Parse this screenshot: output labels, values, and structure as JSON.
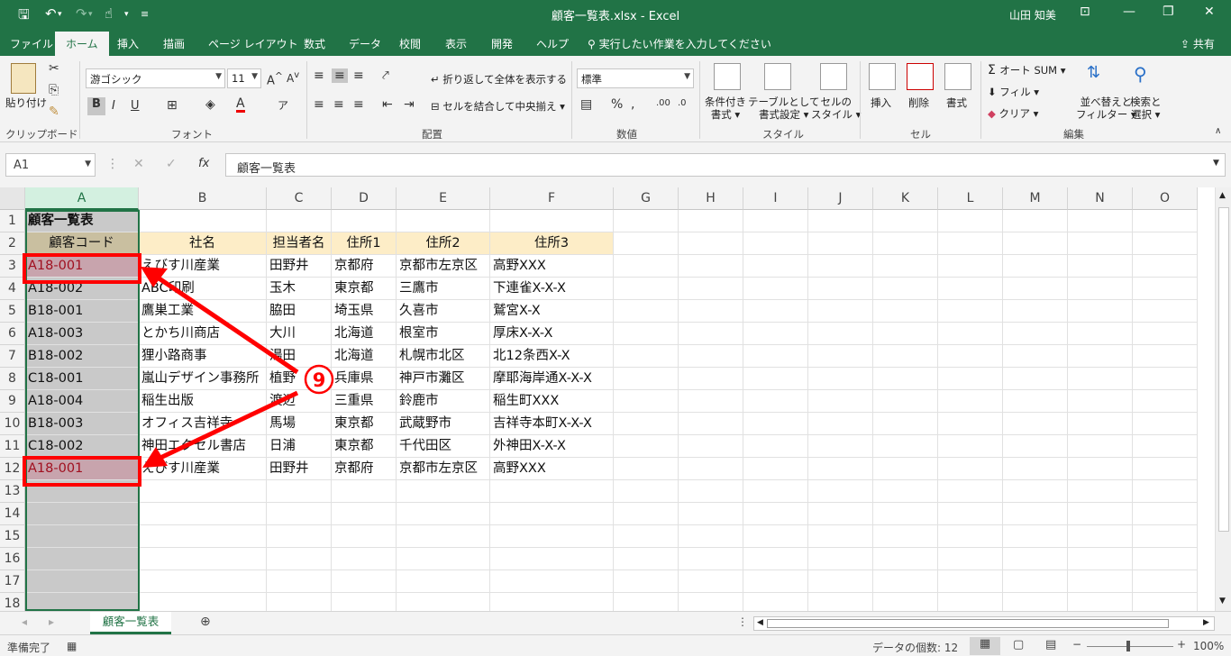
{
  "titlebar": {
    "title": "顧客一覧表.xlsx  -  Excel",
    "user": "山田 知美"
  },
  "tabs": [
    "ファイル",
    "ホーム",
    "挿入",
    "描画",
    "ページ レイアウト",
    "数式",
    "データ",
    "校閲",
    "表示",
    "開発",
    "ヘルプ"
  ],
  "tell_me": "実行したい作業を入力してください",
  "share": "共有",
  "ribbon": {
    "clipboard": {
      "label": "クリップボード",
      "paste": "貼り付け"
    },
    "font": {
      "label": "フォント",
      "name": "游ゴシック",
      "size": "11"
    },
    "alignment": {
      "label": "配置",
      "wrap": "折り返して全体を表示する",
      "merge": "セルを結合して中央揃え"
    },
    "number": {
      "label": "数値",
      "format": "標準"
    },
    "styles": {
      "label": "スタイル",
      "cond_line1": "条件付き",
      "cond_line2": "書式",
      "table_line1": "テーブルとして",
      "table_line2": "書式設定",
      "cell_line1": "セルの",
      "cell_line2": "スタイル"
    },
    "cells": {
      "label": "セル",
      "insert": "挿入",
      "delete": "削除",
      "format": "書式"
    },
    "editing": {
      "label": "編集",
      "autosum": "オート SUM",
      "fill": "フィル",
      "clear": "クリア",
      "sort_line1": "並べ替えと",
      "sort_line2": "フィルター",
      "find_line1": "検索と",
      "find_line2": "選択"
    }
  },
  "formula": {
    "namebox": "A1",
    "content": "顧客一覧表"
  },
  "columns": [
    "A",
    "B",
    "C",
    "D",
    "E",
    "F",
    "G",
    "H",
    "I",
    "J",
    "K",
    "L",
    "M",
    "N",
    "O"
  ],
  "rows": [
    "1",
    "2",
    "3",
    "4",
    "5",
    "6",
    "7",
    "8",
    "9",
    "10",
    "11",
    "12",
    "13",
    "14",
    "15",
    "16",
    "17",
    "18"
  ],
  "sheet": {
    "title": "顧客一覧表",
    "headers": [
      "顧客コード",
      "社名",
      "担当者名",
      "住所1",
      "住所2",
      "住所3"
    ],
    "records": [
      [
        "A18-001",
        "えびす川産業",
        "田野井",
        "京都府",
        "京都市左京区",
        "高野XXX"
      ],
      [
        "A18-002",
        "ABC印刷",
        "玉木",
        "東京都",
        "三鷹市",
        "下連雀X-X-X"
      ],
      [
        "B18-001",
        "鷹巣工業",
        "脇田",
        "埼玉県",
        "久喜市",
        "鷲宮X-X"
      ],
      [
        "A18-003",
        "とかち川商店",
        "大川",
        "北海道",
        "根室市",
        "厚床X-X-X"
      ],
      [
        "B18-002",
        "狸小路商事",
        "湯田",
        "北海道",
        "札幌市北区",
        "北12条西X-X"
      ],
      [
        "C18-001",
        "嵐山デザイン事務所",
        "植野",
        "兵庫県",
        "神戸市灘区",
        "摩耶海岸通X-X-X"
      ],
      [
        "A18-004",
        "稲生出版",
        "渡辺",
        "三重県",
        "鈴鹿市",
        "稲生町XXX"
      ],
      [
        "B18-003",
        "オフィス吉祥寺",
        "馬場",
        "東京都",
        "武蔵野市",
        "吉祥寺本町X-X-X"
      ],
      [
        "C18-002",
        "神田エクセル書店",
        "日浦",
        "東京都",
        "千代田区",
        "外神田X-X-X"
      ],
      [
        "A18-001",
        "えびす川産業",
        "田野井",
        "京都府",
        "京都市左京区",
        "高野XXX"
      ]
    ]
  },
  "annotation": {
    "step": "9"
  },
  "sheet_tab": "顧客一覧表",
  "status": {
    "ready": "準備完了",
    "count": "データの個数: 12",
    "zoom": "100%"
  }
}
